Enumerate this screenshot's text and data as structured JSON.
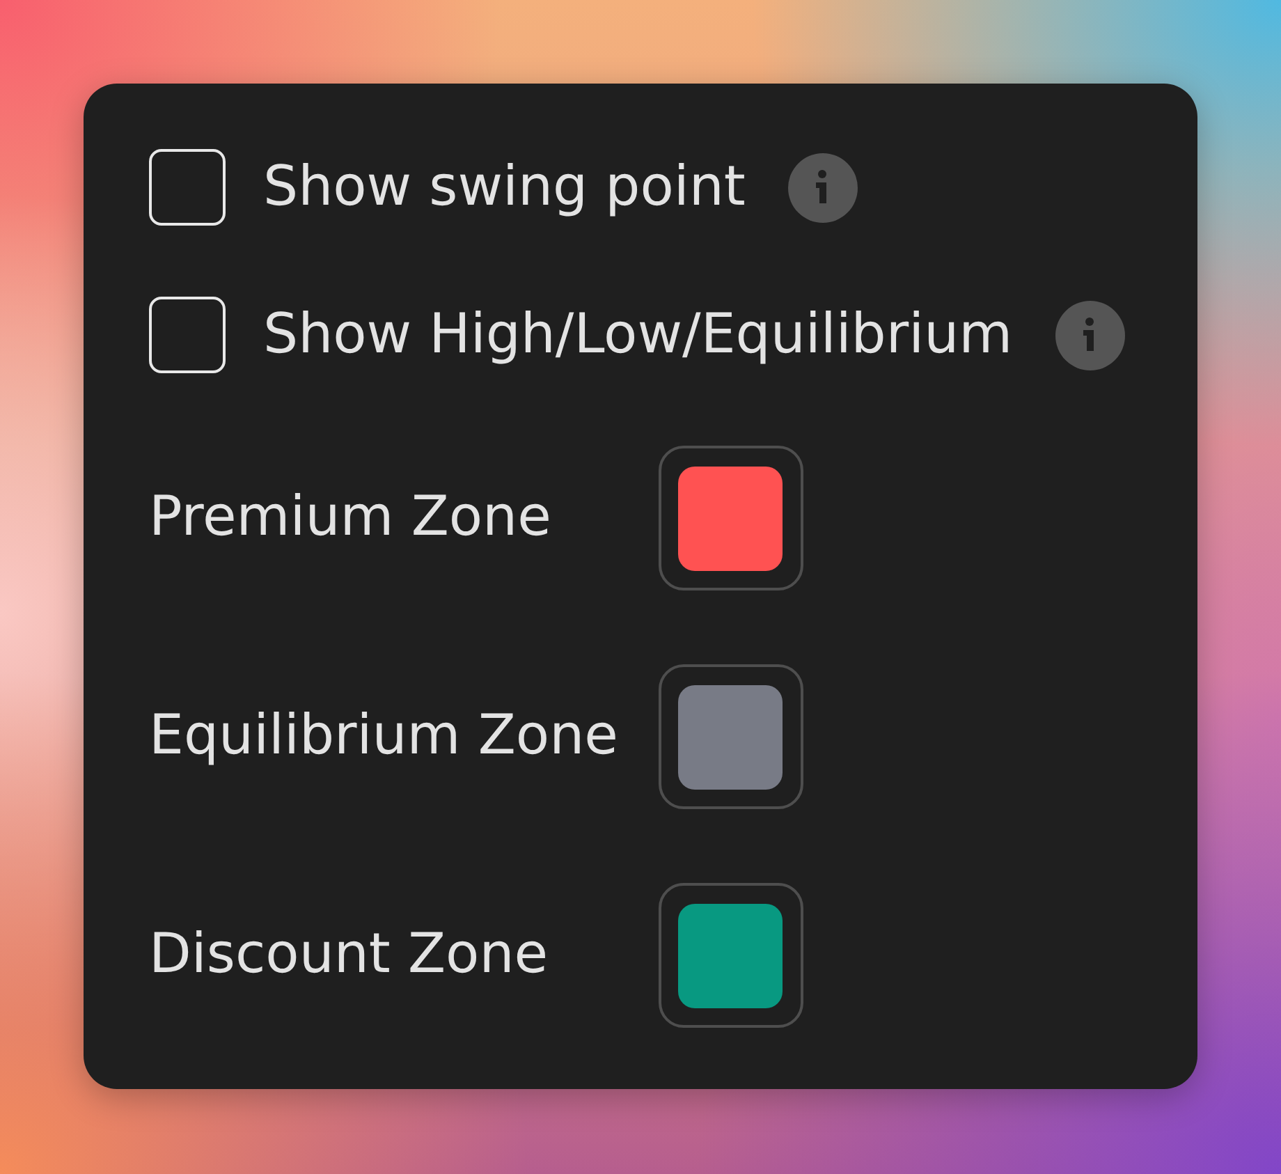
{
  "panel": {
    "checkboxes": [
      {
        "label": "Show swing point",
        "checked": false
      },
      {
        "label": "Show High/Low/Equilibrium",
        "checked": false
      }
    ],
    "color_settings": [
      {
        "label": "Premium Zone",
        "color": "#ff5252"
      },
      {
        "label": "Equilibrium Zone",
        "color": "#787b86"
      },
      {
        "label": "Discount Zone",
        "color": "#089981"
      }
    ]
  }
}
